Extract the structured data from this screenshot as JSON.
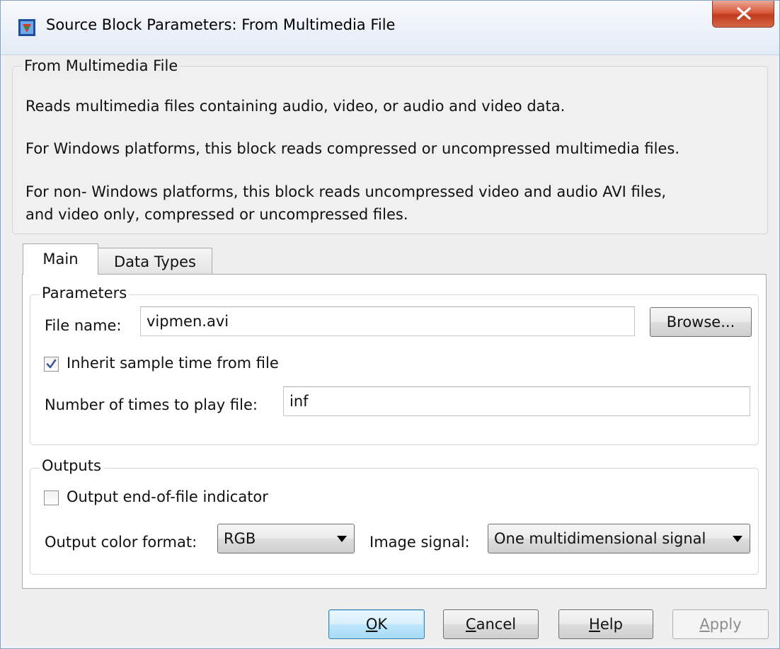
{
  "window": {
    "title": "Source Block Parameters: From Multimedia File",
    "close_glyph": "X"
  },
  "description": {
    "group_title": "From Multimedia File",
    "line1": "Reads multimedia files containing audio, video, or audio and video data.",
    "line2": "For Windows platforms, this block reads compressed or uncompressed multimedia files.",
    "line3a": "For non- Windows platforms, this block reads uncompressed video and audio AVI files,",
    "line3b": "and video only, compressed or uncompressed files."
  },
  "tabs": [
    {
      "label": "Main",
      "selected": true
    },
    {
      "label": "Data Types",
      "selected": false
    }
  ],
  "parameters": {
    "group_title": "Parameters",
    "file_name_label": "File name:",
    "file_name_value": "vipmen.avi",
    "browse_label": "Browse...",
    "inherit_label": "Inherit sample time from file",
    "inherit_checked": true,
    "play_times_label": "Number of times to play file:",
    "play_times_value": "inf"
  },
  "outputs": {
    "group_title": "Outputs",
    "eof_label": "Output end-of-file indicator",
    "eof_checked": false,
    "color_format_label": "Output color format:",
    "color_format_value": "RGB",
    "image_signal_label": "Image signal:",
    "image_signal_value": "One multidimensional signal"
  },
  "buttons": {
    "ok": {
      "mnemonic": "O",
      "rest": "K"
    },
    "cancel": {
      "mnemonic": "C",
      "rest": "ancel"
    },
    "help": {
      "mnemonic": "H",
      "rest": "elp"
    },
    "apply": {
      "mnemonic": "A",
      "rest": "pply",
      "disabled": true
    }
  },
  "colors": {
    "close_red": "#c03b1c",
    "default_button_blue": "#3c7fb1",
    "check_blue": "#3c5a9a"
  },
  "icons": [
    "simulink-block-icon",
    "close-icon",
    "checkmark-icon",
    "dropdown-arrow-icon"
  ]
}
